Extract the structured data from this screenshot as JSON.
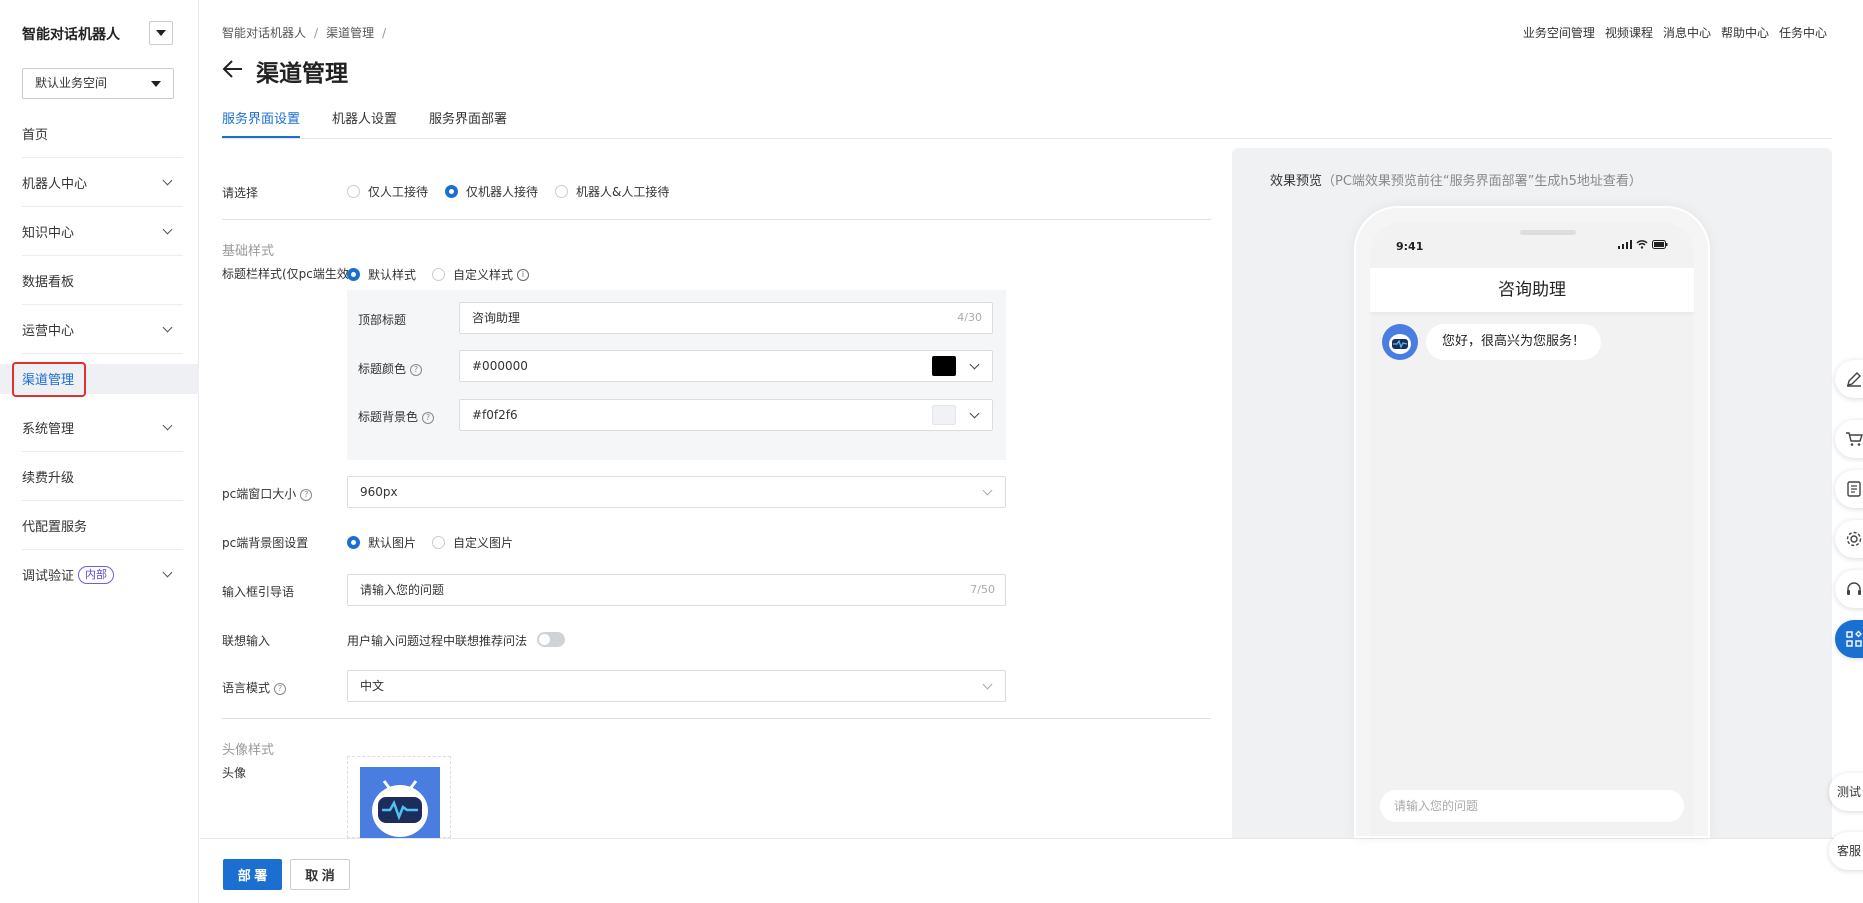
{
  "app": {
    "title": "智能对话机器人",
    "workspace": "默认业务空间"
  },
  "sidebar": {
    "items": [
      {
        "label": "首页",
        "expandable": false
      },
      {
        "label": "机器人中心",
        "expandable": true
      },
      {
        "label": "知识中心",
        "expandable": true
      },
      {
        "label": "数据看板",
        "expandable": false
      },
      {
        "label": "运营中心",
        "expandable": true
      },
      {
        "label": "渠道管理",
        "expandable": false,
        "active": true
      },
      {
        "label": "系统管理",
        "expandable": true
      },
      {
        "label": "续费升级",
        "expandable": false
      },
      {
        "label": "代配置服务",
        "expandable": false
      },
      {
        "label": "调试验证",
        "expandable": true,
        "badge": "内部"
      }
    ]
  },
  "header": {
    "breadcrumb": [
      "智能对话机器人",
      "渠道管理"
    ],
    "top_links": [
      "业务空间管理",
      "视频课程",
      "消息中心",
      "帮助中心",
      "任务中心"
    ],
    "page_title": "渠道管理"
  },
  "tabs": [
    "服务界面设置",
    "机器人设置",
    "服务界面部署"
  ],
  "form": {
    "select_label": "请选择",
    "reception_options": [
      "仅人工接待",
      "仅机器人接待",
      "机器人&人工接待"
    ],
    "basic_style_title": "基础样式",
    "title_bar_label": "标题栏样式(仅pc端生效)",
    "title_bar_options": [
      "默认样式",
      "自定义样式"
    ],
    "top_title_label": "顶部标题",
    "top_title_value": "咨询助理",
    "top_title_count": "4/30",
    "title_color_label": "标题颜色",
    "title_color_value": "#000000",
    "title_bg_label": "标题背景色",
    "title_bg_value": "#f0f2f6",
    "pc_window_label": "pc端窗口大小",
    "pc_window_value": "960px",
    "pc_bg_label": "pc端背景图设置",
    "pc_bg_options": [
      "默认图片",
      "自定义图片"
    ],
    "input_hint_label": "输入框引导语",
    "input_hint_value": "请输入您的问题",
    "input_hint_count": "7/50",
    "assoc_label": "联想输入",
    "assoc_desc": "用户输入问题过程中联想推荐问法",
    "lang_label": "语言模式",
    "lang_value": "中文",
    "avatar_section": "头像样式",
    "avatar_label": "头像"
  },
  "footer": {
    "deploy": "部 署",
    "cancel": "取 消"
  },
  "preview": {
    "title": "效果预览",
    "hint": "（PC端效果预览前往“服务界面部署”生成h5地址查看）",
    "time": "9:41",
    "header": "咨询助理",
    "greeting": "您好，很高兴为您服务！",
    "input_placeholder": "请输入您的问题"
  },
  "floating": {
    "test": "测试",
    "service": "客服"
  },
  "colors": {
    "accent": "#1a6fd1",
    "title_color": "#000000",
    "title_bg": "#f0f2f6"
  }
}
